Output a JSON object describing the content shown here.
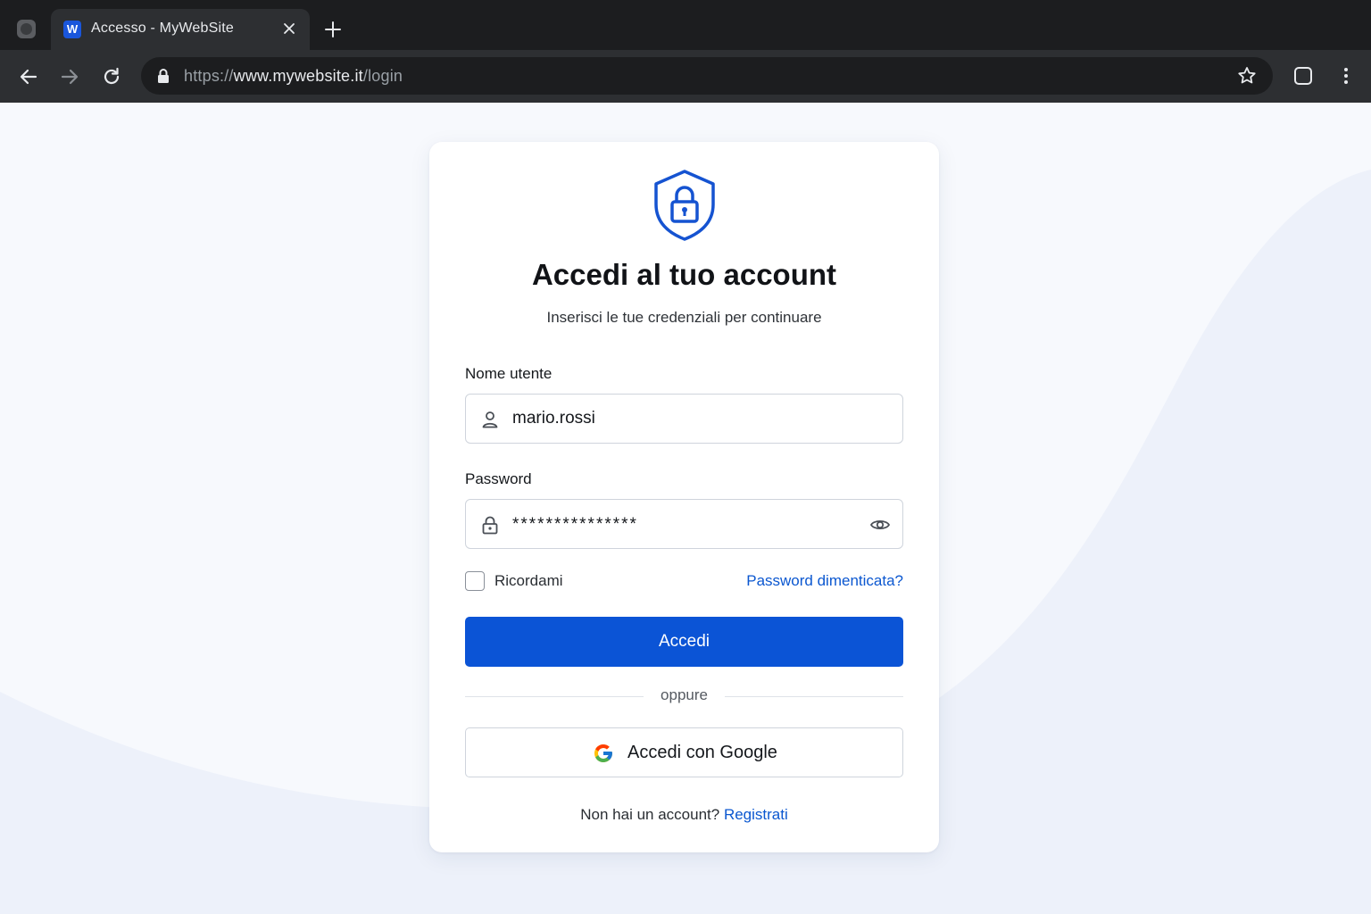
{
  "browser": {
    "tab_title": "Accesso - MyWebSite",
    "tab_favicon_letter": "W",
    "url_scheme": "https://",
    "url_host": "www.mywebsite.it",
    "url_path": "/login",
    "icons": [
      "profile-icon",
      "close-icon",
      "plus-icon",
      "back-icon",
      "forward-icon",
      "reload-icon",
      "lock-icon",
      "star-icon",
      "extensions-icon",
      "menu-icon"
    ]
  },
  "login": {
    "title": "Accedi al tuo account",
    "subtitle": "Inserisci le tue credenziali per continuare",
    "username_label": "Nome utente",
    "username_value": "mario.rossi",
    "password_label": "Password",
    "password_value": "***************",
    "remember_label": "Ricordami",
    "remember_checked": false,
    "forgot_link": "Password dimenticata?",
    "submit_label": "Accedi",
    "divider_text": "oppure",
    "google_label": "Accedi con Google",
    "signup_prompt": "Non hai un account?",
    "signup_link": "Registrati"
  },
  "colors": {
    "accent": "#0b54d6",
    "link": "#0b57d0",
    "chrome_dark": "#1c1d1f",
    "chrome_toolbar": "#2d2f32",
    "page_bg": "#f7f9fd"
  }
}
